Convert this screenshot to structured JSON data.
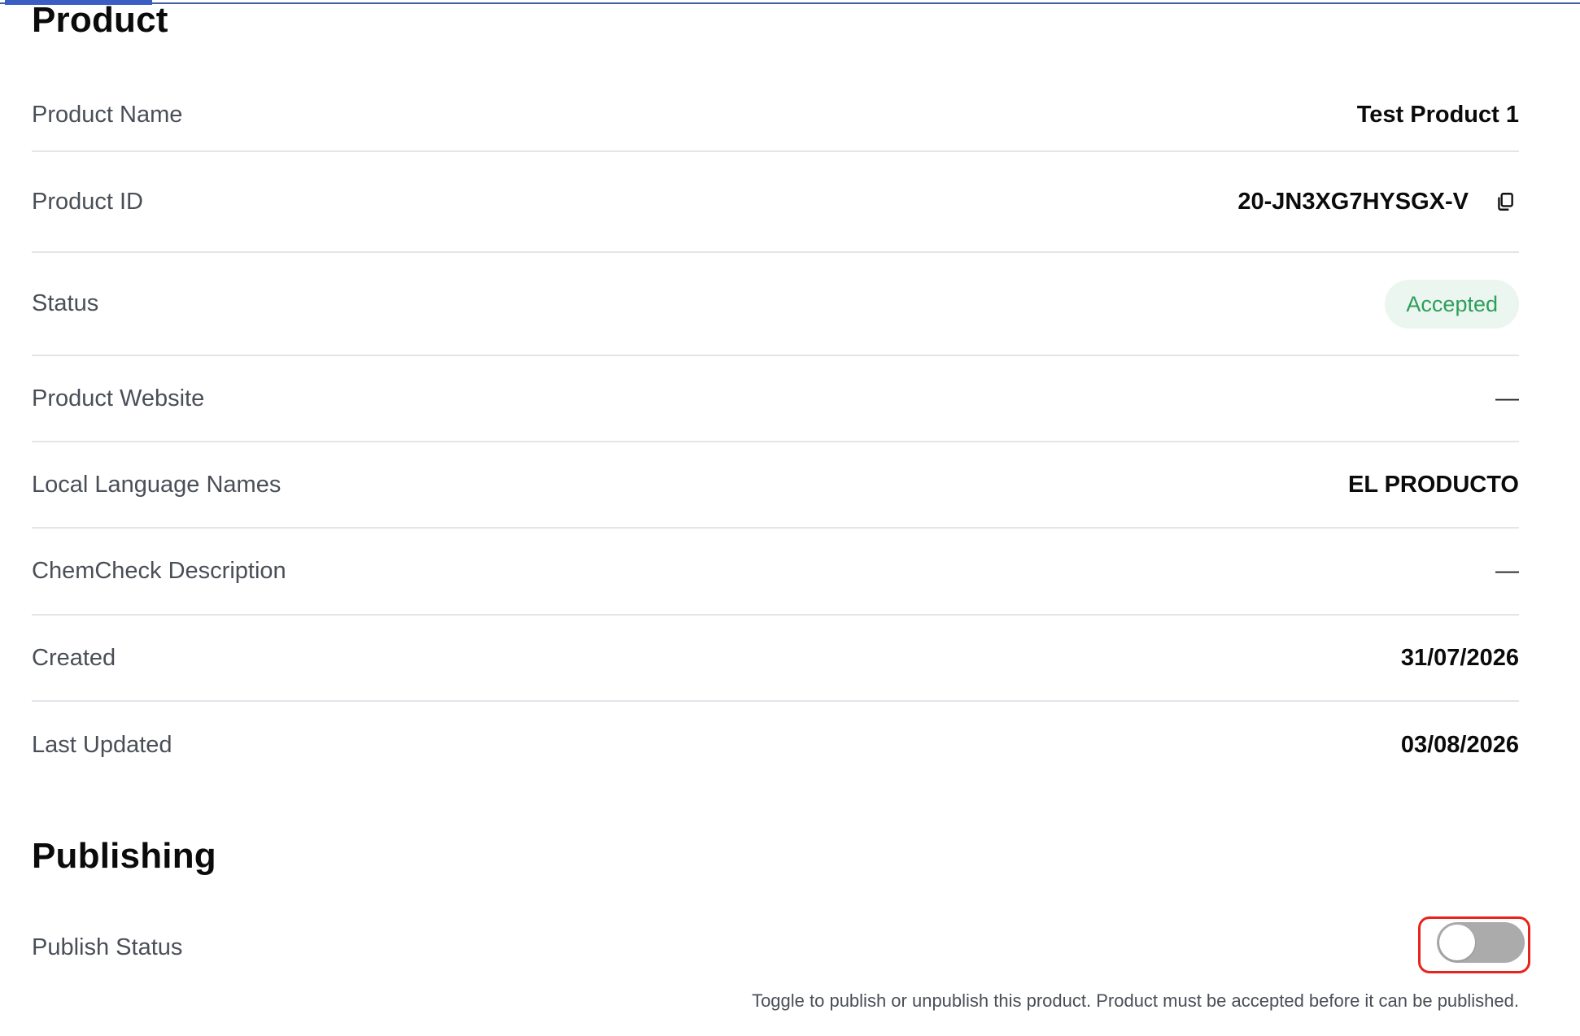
{
  "product": {
    "title": "Product",
    "rows": {
      "name": {
        "label": "Product Name",
        "value": "Test Product 1"
      },
      "id": {
        "label": "Product ID",
        "value": "20-JN3XG7HYSGX-V",
        "icon": "copy-icon"
      },
      "status": {
        "label": "Status",
        "value": "Accepted",
        "color": "#2e9e5b",
        "background": "#eaf6ef"
      },
      "website": {
        "label": "Product Website",
        "value": "—"
      },
      "local_names": {
        "label": "Local Language Names",
        "value": "EL PRODUCTO"
      },
      "chemcheck": {
        "label": "ChemCheck Description",
        "value": "—"
      },
      "created": {
        "label": "Created",
        "value": "31/07/2026"
      },
      "updated": {
        "label": "Last Updated",
        "value": "03/08/2026"
      }
    }
  },
  "publishing": {
    "title": "Publishing",
    "publish_status": {
      "label": "Publish Status",
      "checked": false,
      "helper": "Toggle to publish or unpublish this product. Product must be accepted before it can be published."
    }
  },
  "colors": {
    "accent": "#3a5fc4",
    "focus_ring": "#e8231a",
    "toggle_off": "#ababab"
  }
}
